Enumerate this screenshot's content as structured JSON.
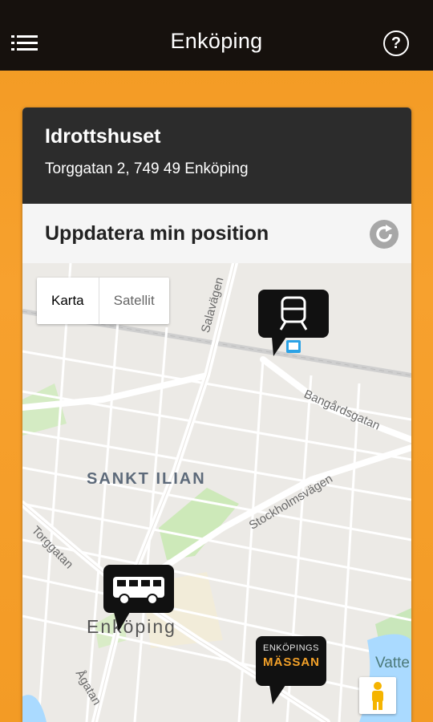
{
  "appbar": {
    "title": "Enköping"
  },
  "venue": {
    "name": "Idrottshuset",
    "address": "Torggatan 2, 749 49 Enköping"
  },
  "update_position": {
    "label": "Uppdatera min position"
  },
  "map": {
    "map_types": [
      "Karta",
      "Satellit"
    ],
    "labels": {
      "district": "SANKT ILIAN",
      "city": "Enköping",
      "salavagen": "Salavägen",
      "bangardsgatan": "Bangårdsgatan",
      "stockholmsvagen": "Stockholmsvägen",
      "torggatan": "Torggatan",
      "agatan": "Ågatan",
      "vatten": "Vatte"
    },
    "markers": {
      "train": "train-icon",
      "bus": "bus-icon",
      "massan_top": "ENKÖPINGS",
      "massan_bottom": "MÄSSAN"
    }
  }
}
